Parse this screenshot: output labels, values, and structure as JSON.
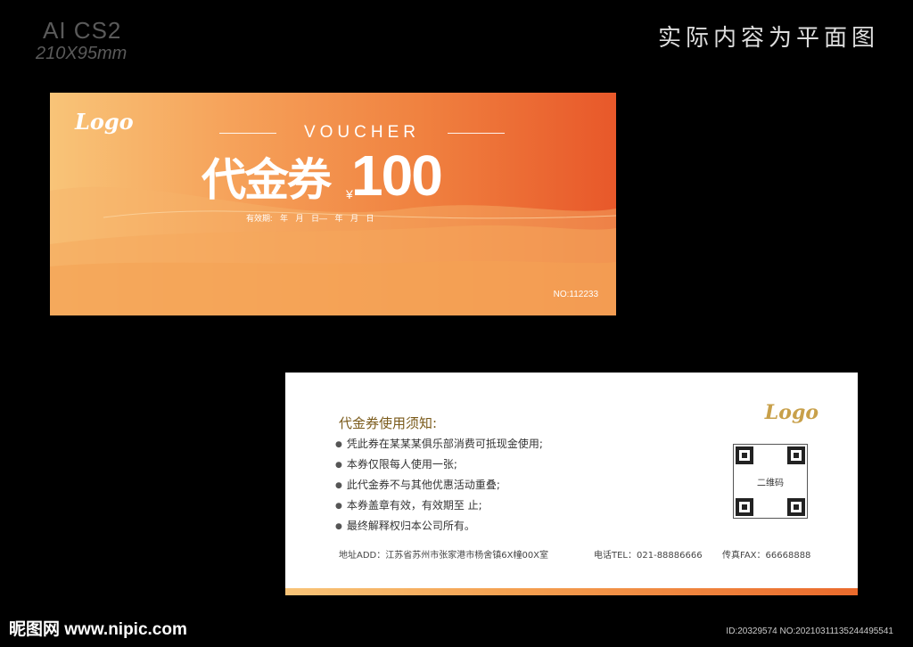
{
  "header": {
    "format_line1": "AI CS2",
    "format_line2": "210X95mm",
    "caption": "实际内容为平面图"
  },
  "front": {
    "logo": "Logo",
    "voucher_word": "VOUCHER",
    "title": "代金券",
    "currency": "¥",
    "amount": "100",
    "validity": "有效期:    年  月  日—  年  月  日",
    "serial": "NO:112233"
  },
  "back": {
    "logo": "Logo",
    "rules_title": "代金券使用须知:",
    "rules": [
      "凭此券在某某某俱乐部消费可抵现金使用;",
      "本券仅限每人使用一张;",
      "此代金券不与其他优惠活动重叠;",
      "本券盖章有效，有效期至            止;",
      "最终解释权归本公司所有。"
    ],
    "qr_label": "二维码",
    "address": "地址ADD：江苏省苏州市张家港市杨舍镇6X幢00X室",
    "phone": "电话TEL：021-88886666",
    "fax": "传真FAX：66668888"
  },
  "watermark": {
    "site": "昵图网 www.nipic.com",
    "id": "ID:20329574 NO:20210311135244495541"
  },
  "colors": {
    "orange_light": "#f8c478",
    "orange_dark": "#e8582a",
    "gold": "#c8a04a"
  }
}
